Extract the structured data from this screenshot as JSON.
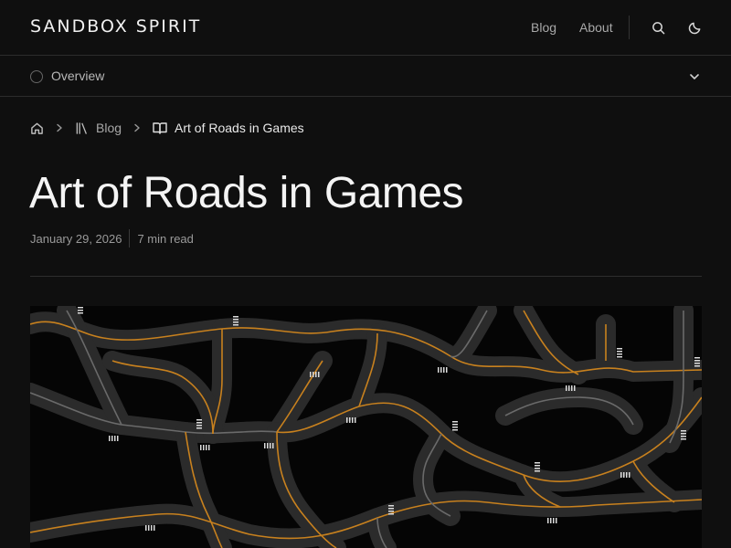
{
  "header": {
    "site_title": "SANDBOX SPIRIT",
    "nav": [
      {
        "label": "Blog"
      },
      {
        "label": "About"
      }
    ]
  },
  "overview": {
    "label": "Overview"
  },
  "breadcrumb": {
    "items": [
      {
        "label": "",
        "icon": "home-icon"
      },
      {
        "label": "Blog",
        "icon": "library-icon"
      },
      {
        "label": "Art of Roads in Games",
        "icon": "open-book-icon"
      }
    ]
  },
  "article": {
    "title": "Art of Roads in Games",
    "date": "January 29, 2026",
    "read_time": "7 min read"
  },
  "colors": {
    "background": "#0f0f0f",
    "road": "#2a2a2a",
    "lane_line": "#c8811e",
    "crosswalk": "#e0e0e0"
  }
}
